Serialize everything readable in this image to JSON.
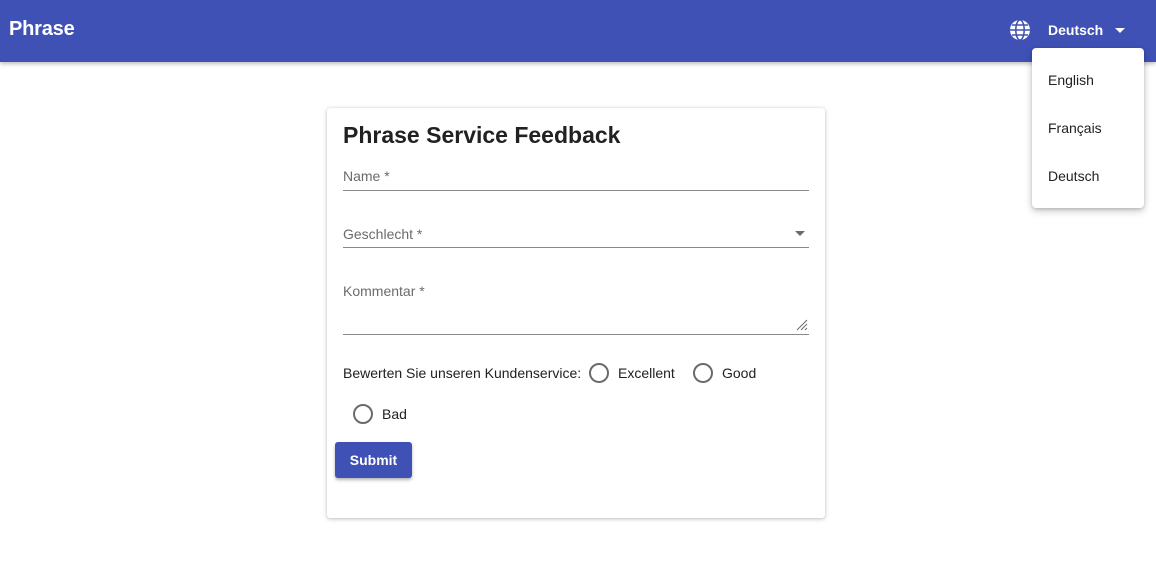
{
  "appbar": {
    "brand": "Phrase",
    "language_icon": "globe-icon",
    "current_language": "Deutsch",
    "color": "#3f51b5"
  },
  "language_menu": {
    "items": [
      "English",
      "Français",
      "Deutsch"
    ]
  },
  "form": {
    "title": "Phrase Service Feedback",
    "name_label": "Name *",
    "gender_label": "Geschlecht *",
    "comment_label": "Kommentar *",
    "rating_label": "Bewerten Sie unseren Kundenservice:",
    "rating_options": [
      "Excellent",
      "Good",
      "Bad"
    ],
    "submit_label": "Submit"
  }
}
